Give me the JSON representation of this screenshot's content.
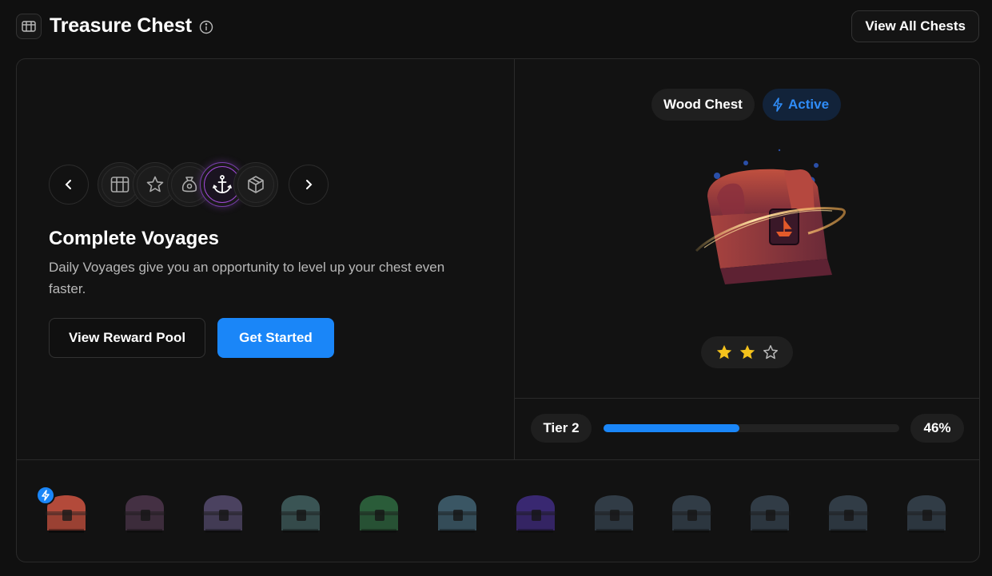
{
  "header": {
    "title": "Treasure Chest",
    "view_all_label": "View All Chests"
  },
  "voyages": {
    "categories": [
      "chest-icon",
      "star-icon",
      "bag-icon",
      "anchor-icon",
      "cube-icon"
    ],
    "active_category": "anchor-icon",
    "title": "Complete Voyages",
    "description": "Daily Voyages give you an opportunity to level up your chest even faster.",
    "view_reward_label": "View Reward Pool",
    "get_started_label": "Get Started"
  },
  "chest": {
    "name": "Wood Chest",
    "status": "Active",
    "stars_filled": 2,
    "stars_total": 3,
    "tier_label": "Tier 2",
    "progress": 0.46,
    "progress_label": "46%"
  },
  "chest_row": {
    "chests": [
      {
        "name": "wood",
        "color": "#b34a3a",
        "active": true
      },
      {
        "name": "bronze",
        "color": "#6d4a6b",
        "active": false
      },
      {
        "name": "silver-purple",
        "color": "#7a6aa0",
        "active": false
      },
      {
        "name": "jade",
        "color": "#5b8a8a",
        "active": false
      },
      {
        "name": "emerald",
        "color": "#3f9a5a",
        "active": false
      },
      {
        "name": "crystal",
        "color": "#5c8fa8",
        "active": false
      },
      {
        "name": "amethyst",
        "color": "#5a3ac0",
        "active": false
      },
      {
        "name": "locked",
        "color": "#4b5f72",
        "active": false
      },
      {
        "name": "locked",
        "color": "#4b5f72",
        "active": false
      },
      {
        "name": "locked",
        "color": "#4b5f72",
        "active": false
      },
      {
        "name": "locked",
        "color": "#4b5f72",
        "active": false
      },
      {
        "name": "locked",
        "color": "#4b5f72",
        "active": false
      }
    ]
  },
  "colors": {
    "accent": "#1a86f8",
    "active_category": "#a04ad6",
    "star": "#f4c21c"
  }
}
